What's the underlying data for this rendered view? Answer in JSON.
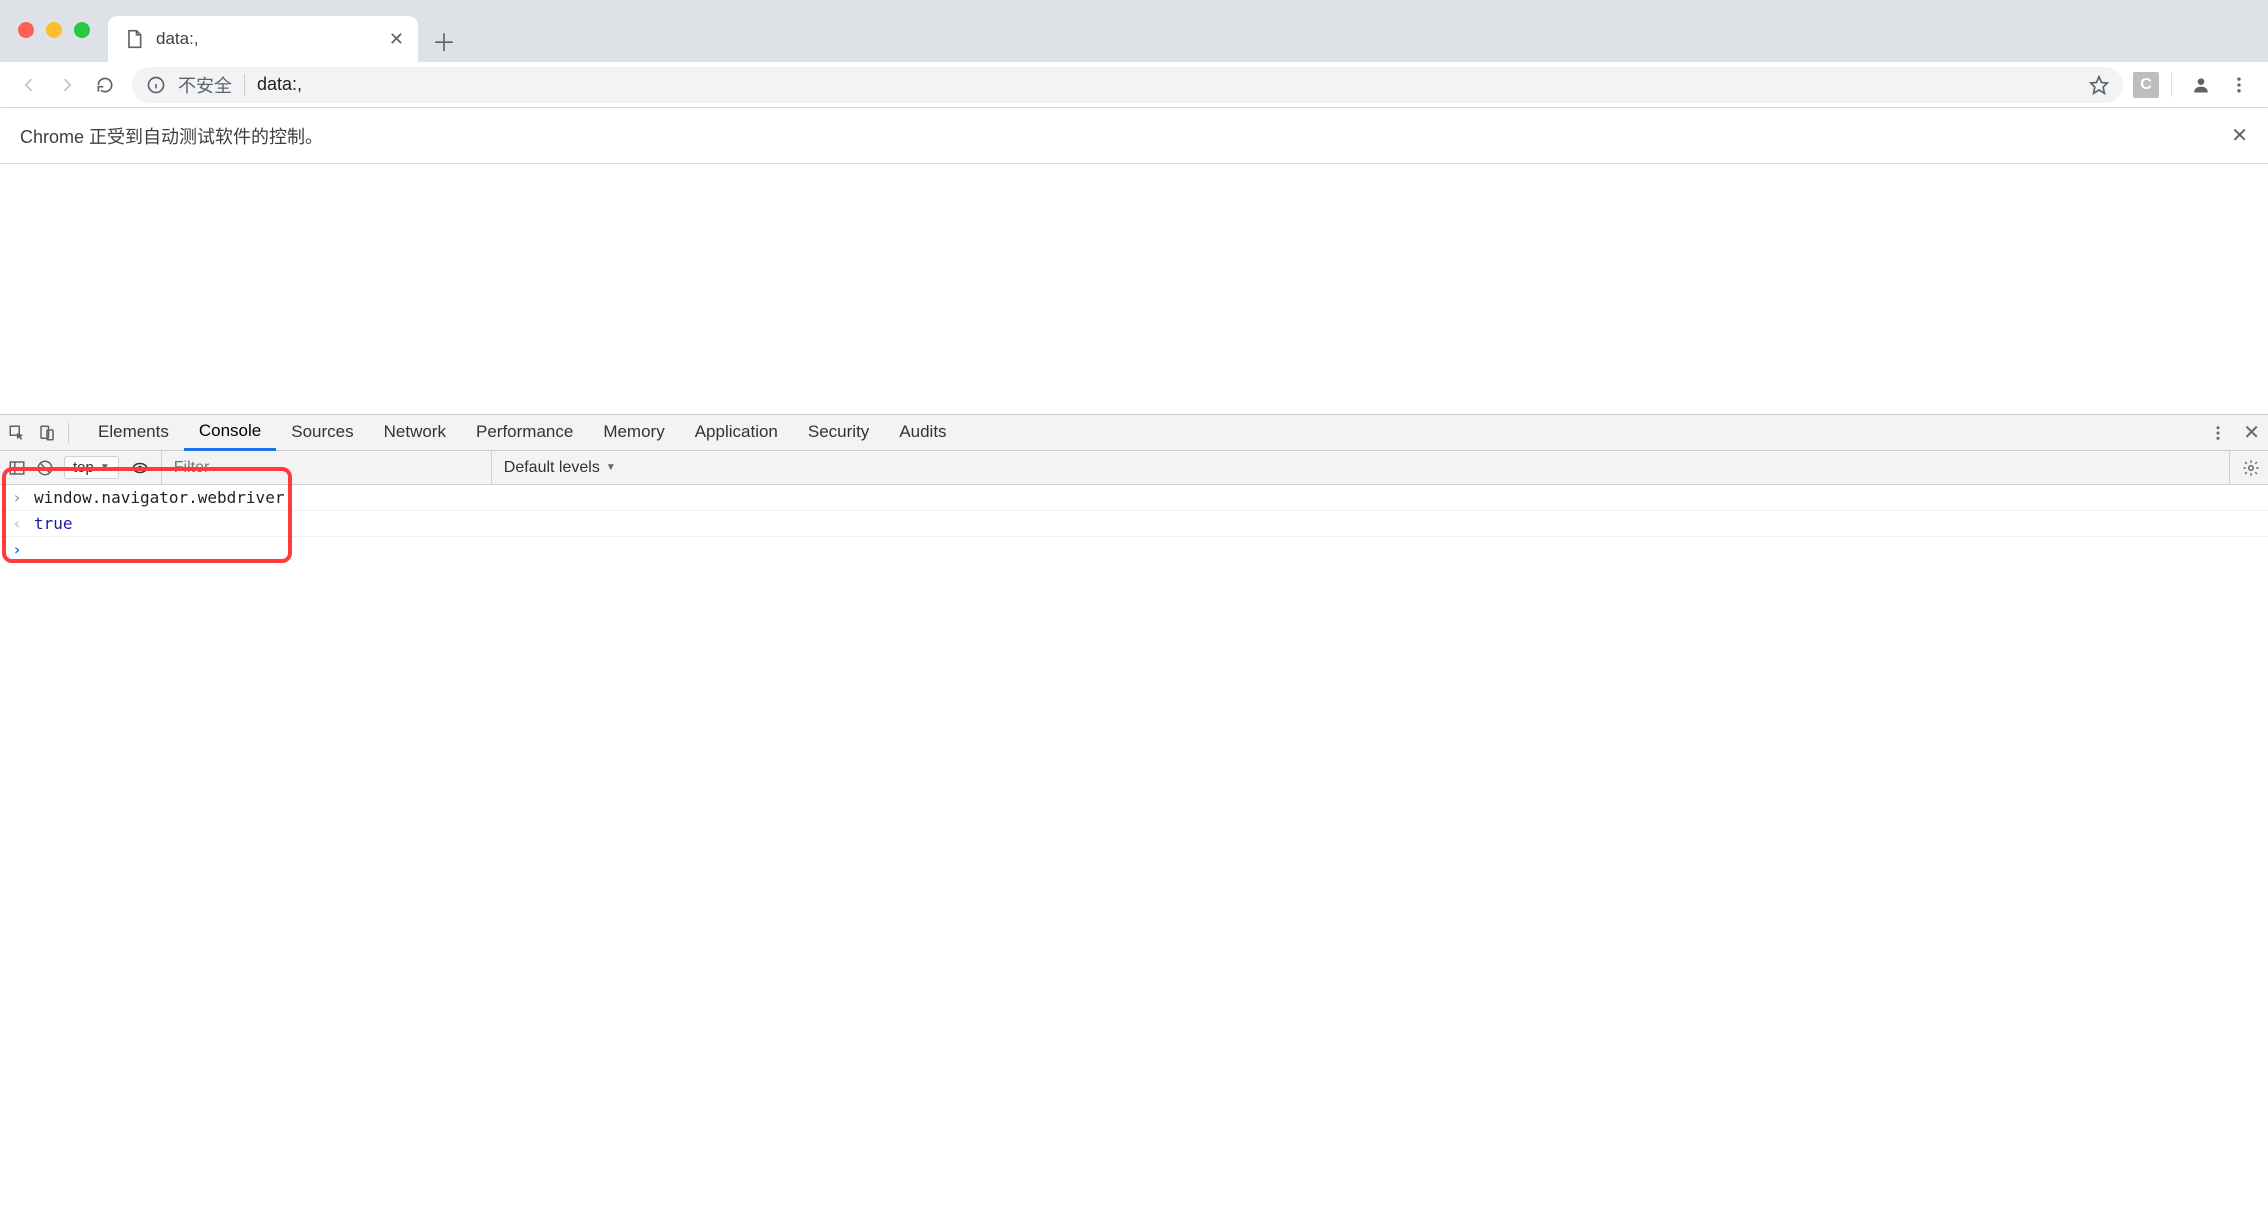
{
  "tab": {
    "title": "data:,"
  },
  "omnibox": {
    "security_label": "不安全",
    "url": "data:,"
  },
  "toolbar": {
    "ext_badge": "C"
  },
  "infobar": {
    "message": "Chrome 正受到自动测试软件的控制。"
  },
  "devtools": {
    "panels": [
      "Elements",
      "Console",
      "Sources",
      "Network",
      "Performance",
      "Memory",
      "Application",
      "Security",
      "Audits"
    ],
    "active_panel": "Console",
    "context": "top",
    "filter_placeholder": "Filter",
    "levels_label": "Default levels",
    "console": {
      "input_line": "window.navigator.webdriver",
      "output_line": "true"
    }
  }
}
